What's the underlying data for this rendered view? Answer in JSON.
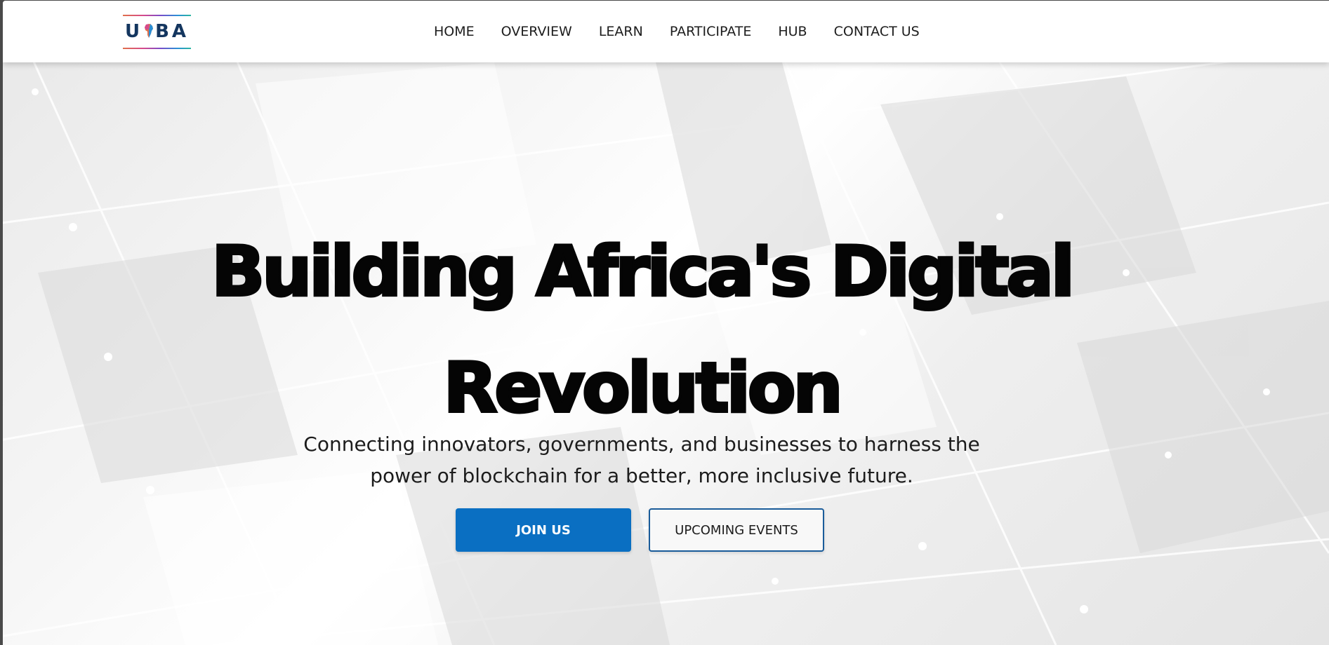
{
  "logo": {
    "text_left": "U",
    "text_right": "BA",
    "icon": "africa-map-icon"
  },
  "nav": {
    "items": [
      "HOME",
      "OVERVIEW",
      "LEARN",
      "PARTICIPATE",
      "HUB",
      "CONTACT US"
    ]
  },
  "hero": {
    "title_line1": "Building Africa's Digital",
    "title_line2": "Revolution",
    "subtitle_line1": "Connecting innovators, governments, and businesses to harness the",
    "subtitle_line2": "power of blockchain for a better, more inclusive future.",
    "primary_button": "JOIN US",
    "secondary_button": "UPCOMING EVENTS"
  },
  "colors": {
    "primary": "#0a6fc2",
    "border_accent": "#1a5c9a",
    "logo_text": "#14365f",
    "title": "#050505"
  }
}
